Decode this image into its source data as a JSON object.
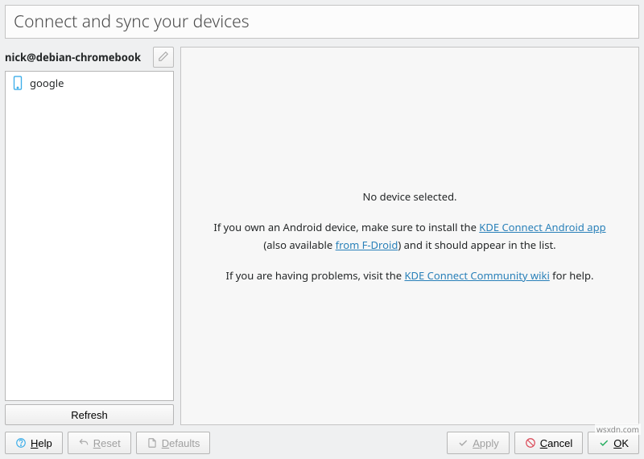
{
  "header": {
    "title": "Connect and sync your devices"
  },
  "sidebar": {
    "hostname": "nick@debian-chromebook",
    "devices": [
      {
        "name": "google"
      }
    ],
    "refresh_label": "Refresh"
  },
  "content": {
    "no_device": "No device selected.",
    "line1_a": "If you own an Android device, make sure to install the ",
    "link1": "KDE Connect Android app",
    "line1_b": " (also available ",
    "link2": "from F-Droid",
    "line1_c": ") and it should appear in the list.",
    "line2_a": "If you are having problems, visit the ",
    "link3": "KDE Connect Community wiki",
    "line2_b": " for help."
  },
  "footer": {
    "help": "Help",
    "reset": "Reset",
    "defaults": "Defaults",
    "apply": "Apply",
    "cancel": "Cancel",
    "ok": "OK"
  },
  "watermark": "wsxdn.com"
}
